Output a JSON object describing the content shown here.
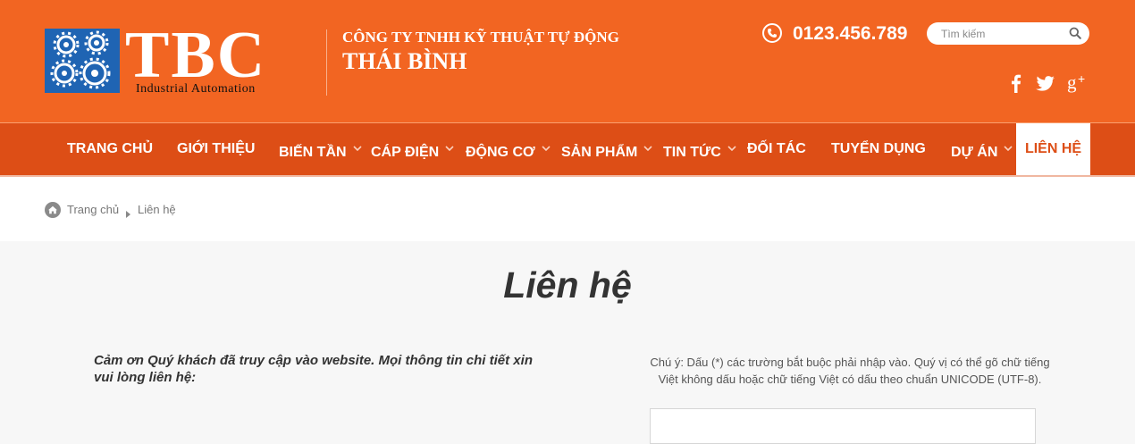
{
  "header": {
    "logo_text": "TBC",
    "logo_subtitle": "Industrial Automation",
    "company_line1": "CÔNG TY TNHH KỸ THUẬT TỰ ĐỘNG",
    "company_line2": "THÁI BÌNH",
    "phone": "0123.456.789",
    "search_placeholder": "Tìm kiếm",
    "social": [
      "facebook-icon",
      "twitter-icon",
      "google-plus-icon"
    ]
  },
  "nav": {
    "items": [
      {
        "label": "TRANG CHỦ",
        "dropdown": false
      },
      {
        "label": "GIỚI THIỆU",
        "dropdown": false
      },
      {
        "label": "BIẾN TẦN",
        "dropdown": true
      },
      {
        "label": "CÁP ĐIỆN",
        "dropdown": true
      },
      {
        "label": "ĐỘNG CƠ",
        "dropdown": true
      },
      {
        "label": "SẢN PHẨM",
        "dropdown": true
      },
      {
        "label": "TIN TỨC",
        "dropdown": true
      },
      {
        "label": "ĐỐI TÁC",
        "dropdown": false
      },
      {
        "label": "TUYỂN DỤNG",
        "dropdown": false
      },
      {
        "label": "DỰ ÁN",
        "dropdown": true
      },
      {
        "label": "LIÊN HỆ",
        "dropdown": false,
        "active": true
      }
    ]
  },
  "breadcrumb": {
    "home": "Trang chủ",
    "current": "Liên hệ"
  },
  "main": {
    "title": "Liên hệ",
    "intro": "Cảm ơn Quý khách đã truy cập vào website. Mọi thông tin chi tiết xin vui lòng liên hệ:",
    "note": "Chú ý: Dấu (*) các trường bắt buộc phải nhập vào. Quý vị có thể gõ chữ tiếng Việt không dấu hoặc chữ tiếng Việt có dấu theo chuẩn UNICODE (UTF-8)."
  },
  "colors": {
    "header_bg": "#f26522",
    "nav_bg": "#dd4e16",
    "logo_blue": "#1f64b3"
  }
}
